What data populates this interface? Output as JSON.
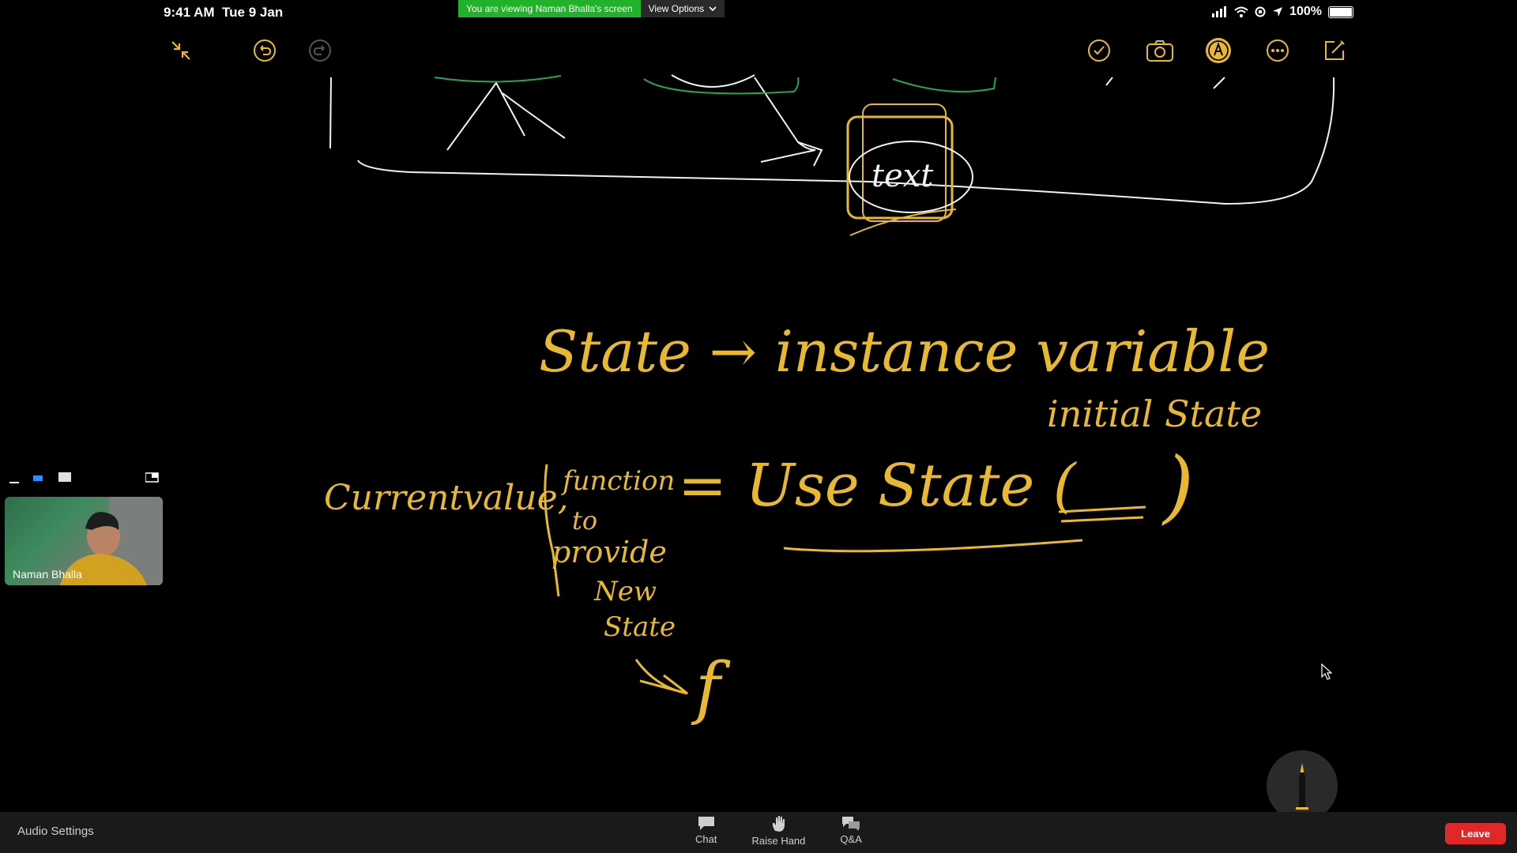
{
  "status_bar": {
    "time": "9:41 AM",
    "date": "Tue 9 Jan",
    "battery": "100%"
  },
  "banner": {
    "viewing_text": "You are viewing Naman Bhalla's screen",
    "view_options_label": "View Options"
  },
  "notes_toolbar": {
    "left": [
      "collapse-icon",
      "undo-icon",
      "redo-icon"
    ],
    "right": [
      "checklist-icon",
      "camera-icon",
      "markup-icon",
      "more-icon",
      "compose-icon"
    ]
  },
  "whiteboard": {
    "line1": "State → instance variable",
    "line2_label": "initial State",
    "line3_left": "Currentvalue,",
    "line3_function": "function",
    "line3_to": "to",
    "line3_provide": "provide",
    "line3_new": "New",
    "line3_state": "State",
    "line3_right": "= Use State (",
    "line3_close": ")",
    "fn_glyph": "f",
    "box_text": "text",
    "ink_color": "#e8b92e",
    "chalk_color": "#f2f2f2",
    "accent_green": "#29a35a"
  },
  "participant": {
    "name": "Naman Bhalla"
  },
  "bottom_bar": {
    "audio_settings": "Audio Settings",
    "chat": "Chat",
    "raise_hand": "Raise Hand",
    "qa": "Q&A",
    "leave": "Leave"
  }
}
